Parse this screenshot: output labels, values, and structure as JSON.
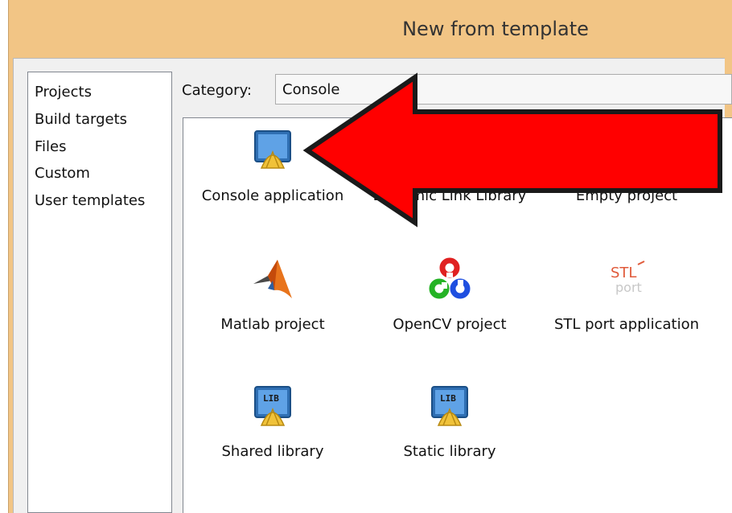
{
  "window": {
    "title": "New from template"
  },
  "categories": {
    "items": [
      {
        "label": "Projects"
      },
      {
        "label": "Build targets"
      },
      {
        "label": "Files"
      },
      {
        "label": "Custom"
      },
      {
        "label": "User templates"
      }
    ]
  },
  "category_selector": {
    "label": "Category:",
    "value": "Console"
  },
  "templates": [
    {
      "label": "Console application",
      "icon": "console-app-icon"
    },
    {
      "label": "Dynamic Link Library",
      "icon": "dll-icon"
    },
    {
      "label": "Empty project",
      "icon": "empty-project-icon"
    },
    {
      "label": "Matlab project",
      "icon": "matlab-icon"
    },
    {
      "label": "OpenCV project",
      "icon": "opencv-icon"
    },
    {
      "label": "STL port application",
      "icon": "stlport-icon"
    },
    {
      "label": "Shared library",
      "icon": "lib-icon"
    },
    {
      "label": "Static library",
      "icon": "lib-icon"
    }
  ],
  "icon_texts": {
    "lib": "LIB",
    "stl": "STL",
    "port": "port"
  },
  "colors": {
    "title_bar": "#f2c585",
    "annotation_arrow": "#ff0000"
  }
}
